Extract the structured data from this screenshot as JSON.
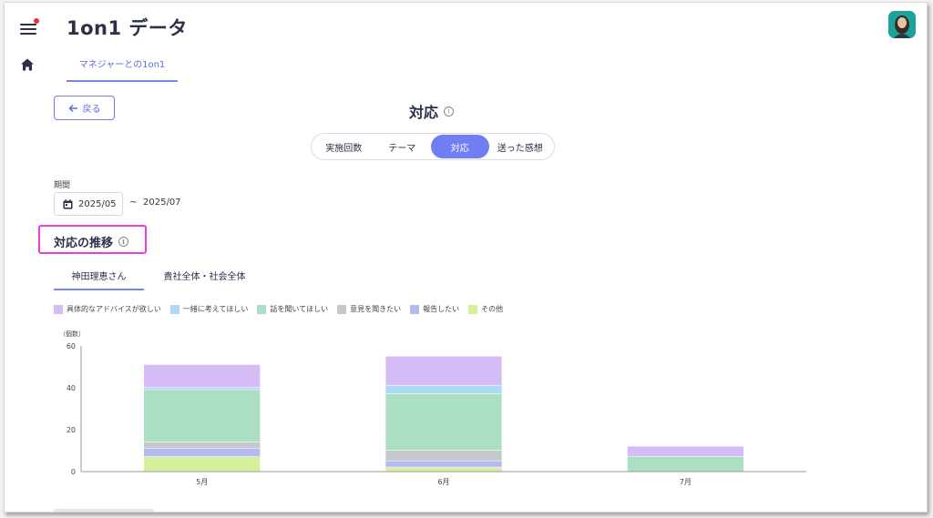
{
  "header": {
    "title": "1on1 データ"
  },
  "nav": {
    "tab_label": "マネジャーとの1on1"
  },
  "back_label": "戻る",
  "page_heading": "対応",
  "segments": [
    {
      "label": "実施回数",
      "active": false
    },
    {
      "label": "テーマ",
      "active": false
    },
    {
      "label": "対応",
      "active": true
    },
    {
      "label": "送った感想",
      "active": false
    }
  ],
  "period": {
    "label": "期間",
    "start": "2025/05",
    "separator": "~",
    "end": "2025/07"
  },
  "section_title": "対応の推移",
  "view_tabs": [
    {
      "label": "神田理恵さん",
      "active": true
    },
    {
      "label": "貴社全体・社会全体",
      "active": false
    }
  ],
  "colors": {
    "accent": "#6f7ef0",
    "highlight": "#e83fd6"
  },
  "chart_data": {
    "type": "bar",
    "stacked": true,
    "categories": [
      "5月",
      "6月",
      "7月"
    ],
    "ylabel": "（個数）",
    "ylim": [
      0,
      60
    ],
    "yticks": [
      0,
      20,
      40,
      60
    ],
    "grid": false,
    "legend_position": "top-left",
    "series": [
      {
        "name": "その他",
        "color": "#d6ef9a",
        "values": [
          7,
          2,
          0
        ]
      },
      {
        "name": "報告したい",
        "color": "#b3baf2",
        "values": [
          4,
          3,
          0
        ]
      },
      {
        "name": "意見を聞きたい",
        "color": "#c6c7cc",
        "values": [
          3,
          5,
          0
        ]
      },
      {
        "name": "話を聞いてほしい",
        "color": "#abdfc4",
        "values": [
          25,
          27,
          7
        ]
      },
      {
        "name": "一緒に考えてほしい",
        "color": "#acd9f4",
        "values": [
          1,
          4,
          0
        ]
      },
      {
        "name": "具体的なアドバイスが欲しい",
        "color": "#d5bcf6",
        "values": [
          11,
          14,
          5
        ]
      }
    ]
  }
}
